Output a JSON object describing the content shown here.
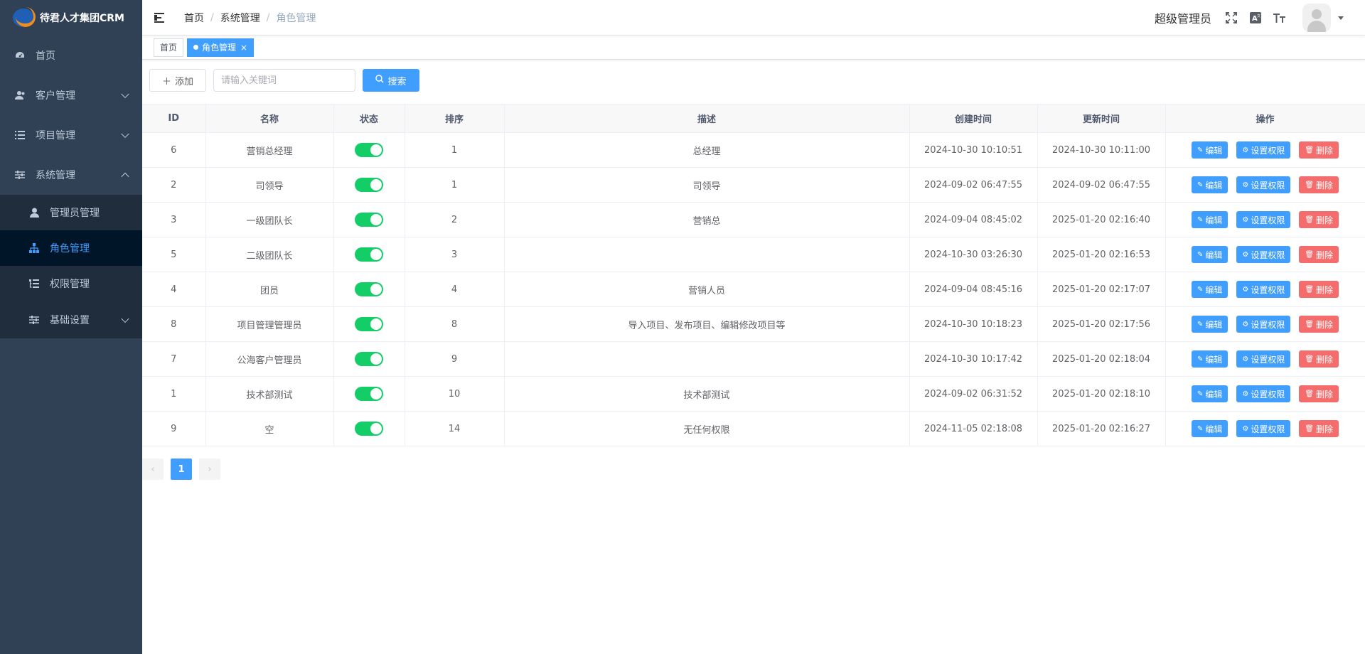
{
  "app": {
    "title": "待君人才集团CRM"
  },
  "sidebar": {
    "items": [
      {
        "label": "首页",
        "icon": "dashboard-icon"
      },
      {
        "label": "客户管理",
        "icon": "customer-icon"
      },
      {
        "label": "项目管理",
        "icon": "list-icon"
      },
      {
        "label": "系统管理",
        "icon": "sliders-icon"
      }
    ],
    "submenu": [
      {
        "label": "管理员管理",
        "icon": "user-icon"
      },
      {
        "label": "角色管理",
        "icon": "org-chart-icon"
      },
      {
        "label": "权限管理",
        "icon": "tree-list-icon"
      },
      {
        "label": "基础设置",
        "icon": "sliders-icon"
      }
    ]
  },
  "navbar": {
    "breadcrumb": [
      "首页",
      "系统管理",
      "角色管理"
    ],
    "user": "超级管理员"
  },
  "tags": [
    {
      "label": "首页"
    },
    {
      "label": "角色管理"
    }
  ],
  "toolbar": {
    "add_label": "添加",
    "search_placeholder": "请输入关键词",
    "search_label": "搜索"
  },
  "table": {
    "headers": [
      "ID",
      "名称",
      "状态",
      "排序",
      "描述",
      "创建时间",
      "更新时间",
      "操作"
    ],
    "actions": {
      "edit": "编辑",
      "perm": "设置权限",
      "del": "删除"
    },
    "rows": [
      {
        "id": "6",
        "name": "营销总经理",
        "enabled": true,
        "sort": "1",
        "desc": "总经理",
        "created": "2024-10-30 10:10:51",
        "updated": "2024-10-30 10:11:00"
      },
      {
        "id": "2",
        "name": "司领导",
        "enabled": true,
        "sort": "1",
        "desc": "司领导",
        "created": "2024-09-02 06:47:55",
        "updated": "2024-09-02 06:47:55"
      },
      {
        "id": "3",
        "name": "一级团队长",
        "enabled": true,
        "sort": "2",
        "desc": "营销总",
        "created": "2024-09-04 08:45:02",
        "updated": "2025-01-20 02:16:40"
      },
      {
        "id": "5",
        "name": "二级团队长",
        "enabled": true,
        "sort": "3",
        "desc": "",
        "created": "2024-10-30 03:26:30",
        "updated": "2025-01-20 02:16:53"
      },
      {
        "id": "4",
        "name": "团员",
        "enabled": true,
        "sort": "4",
        "desc": "营销人员",
        "created": "2024-09-04 08:45:16",
        "updated": "2025-01-20 02:17:07"
      },
      {
        "id": "8",
        "name": "项目管理管理员",
        "enabled": true,
        "sort": "8",
        "desc": "导入项目、发布项目、编辑修改项目等",
        "created": "2024-10-30 10:18:23",
        "updated": "2025-01-20 02:17:56"
      },
      {
        "id": "7",
        "name": "公海客户管理员",
        "enabled": true,
        "sort": "9",
        "desc": "",
        "created": "2024-10-30 10:17:42",
        "updated": "2025-01-20 02:18:04"
      },
      {
        "id": "1",
        "name": "技术部测试",
        "enabled": true,
        "sort": "10",
        "desc": "技术部测试",
        "created": "2024-09-02 06:31:52",
        "updated": "2025-01-20 02:18:10"
      },
      {
        "id": "9",
        "name": "空",
        "enabled": true,
        "sort": "14",
        "desc": "无任何权限",
        "created": "2024-11-05 02:18:08",
        "updated": "2025-01-20 02:16:27"
      }
    ]
  },
  "pagination": {
    "current": "1"
  },
  "colors": {
    "sidebar": "#304156",
    "primary": "#409eff",
    "danger": "#f56c6c",
    "switch_on": "#13ce66"
  }
}
